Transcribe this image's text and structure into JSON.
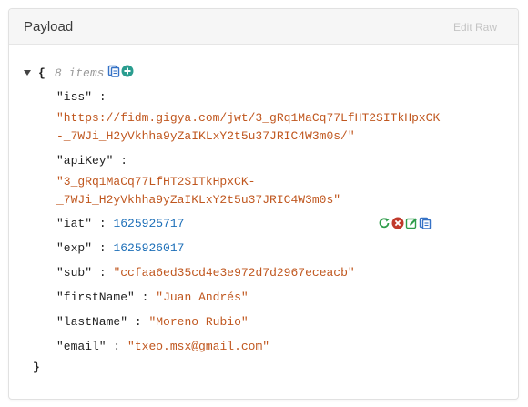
{
  "panel": {
    "title": "Payload",
    "edit_raw_label": "Edit Raw"
  },
  "root": {
    "open_brace": "{",
    "close_brace": "}",
    "count_label": "8 items"
  },
  "entries": [
    {
      "key": "\"iss\"",
      "value_lines": [
        "\"https://fidm.gigya.com/jwt/3_gRq1MaCq77LfHT2SITkHpxCK",
        "-_7WJi_H2yVkhha9yZaIKLxY2t5u37JRIC4W3m0s/\""
      ],
      "type": "string"
    },
    {
      "key": "\"apiKey\"",
      "value_lines": [
        "\"3_gRq1MaCq77LfHT2SITkHpxCK-",
        "_7WJi_H2yVkhha9yZaIKLxY2t5u37JRIC4W3m0s\""
      ],
      "type": "string"
    },
    {
      "key": "\"iat\"",
      "value": "1625925717",
      "type": "number"
    },
    {
      "key": "\"exp\"",
      "value": "1625926017",
      "type": "number"
    },
    {
      "key": "\"sub\"",
      "value": "\"ccfaa6ed35cd4e3e972d7d2967eceacb\"",
      "type": "string"
    },
    {
      "key": "\"firstName\"",
      "value": "\"Juan Andrés\"",
      "type": "string"
    },
    {
      "key": "\"lastName\"",
      "value": "\"Moreno Rubio\"",
      "type": "string"
    },
    {
      "key": "\"email\"",
      "value": "\"txeo.msx@gmail.com\"",
      "type": "string"
    }
  ],
  "separator": ":",
  "icons": {
    "root": [
      "copy-icon",
      "add-icon"
    ],
    "row_hover": [
      "type-toggle-icon",
      "delete-icon",
      "edit-icon",
      "copy-icon"
    ]
  },
  "colors": {
    "string": "#c0571f",
    "number": "#1d6fb8",
    "add": "#2a9d8f",
    "delete": "#c0392b",
    "edit": "#2e9c4a",
    "copy": "#3572c6"
  }
}
